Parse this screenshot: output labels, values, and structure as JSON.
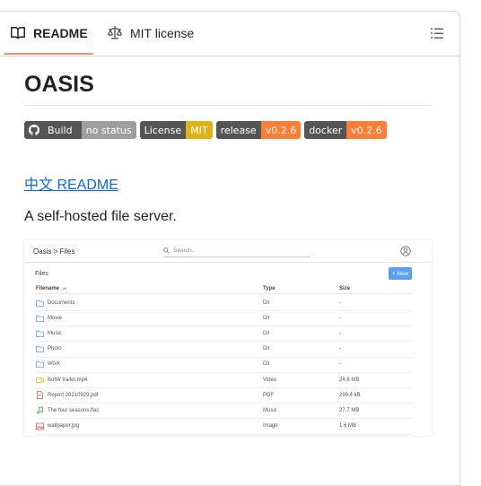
{
  "tabs": [
    {
      "label": "README",
      "active": true
    },
    {
      "label": "MIT license",
      "active": false
    }
  ],
  "readme": {
    "title": "OASIS",
    "badges": [
      {
        "left": "Build",
        "right": "no status",
        "color": "#9f9f9f",
        "icon": "github-icon"
      },
      {
        "left": "License",
        "right": "MIT",
        "color": "#dfb317"
      },
      {
        "left": "release",
        "right": "v0.2.6",
        "color": "#fe7d37"
      },
      {
        "left": "docker",
        "right": "v0.2.6",
        "color": "#fe7d37"
      }
    ],
    "zh_link": "中文 README",
    "description": "A self-hosted file server."
  },
  "screenshot": {
    "breadcrumb": "Oasis > Files",
    "search_placeholder": "Search..",
    "section": "Files",
    "new_button": "+ New",
    "columns": [
      "Filename",
      "Type",
      "Size"
    ],
    "rows": [
      {
        "name": "Documents",
        "type": "Dir",
        "size": "-",
        "icon": "folder-icon"
      },
      {
        "name": "Movie",
        "type": "Dir",
        "size": "-",
        "icon": "folder-icon"
      },
      {
        "name": "Music",
        "type": "Dir",
        "size": "-",
        "icon": "folder-icon"
      },
      {
        "name": "Photo",
        "type": "Dir",
        "size": "-",
        "icon": "folder-icon"
      },
      {
        "name": "Work",
        "type": "Dir",
        "size": "-",
        "icon": "folder-icon"
      },
      {
        "name": "BotW trailer.mp4",
        "type": "Video",
        "size": "24.6 MB",
        "icon": "video-icon"
      },
      {
        "name": "Report 20210929.pdf",
        "type": "PDF",
        "size": "299.4 kB",
        "icon": "pdf-icon"
      },
      {
        "name": "The four seasons.flac",
        "type": "Music",
        "size": "27.7 MB",
        "icon": "music-icon"
      },
      {
        "name": "wallpaper.jpg",
        "type": "Image",
        "size": "1.6 MB",
        "icon": "image-icon"
      }
    ]
  },
  "colors": {
    "accent": "#fd8c73",
    "link": "#0969da",
    "new_button": "#5b9ff0",
    "folder": "#5b9ff0",
    "video": "#f2b632",
    "pdf": "#e5534b",
    "music": "#3fb950",
    "image": "#e5534b"
  }
}
